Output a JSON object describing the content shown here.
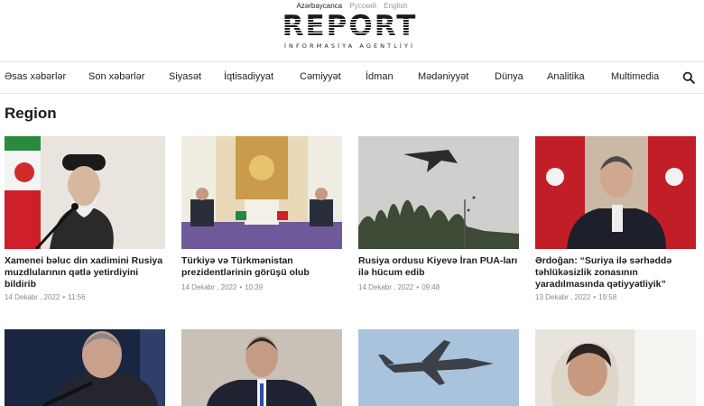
{
  "languages": [
    {
      "label": "Azərbaycanca",
      "active": true
    },
    {
      "label": "Русский",
      "active": false
    },
    {
      "label": "English",
      "active": false
    }
  ],
  "logo": {
    "word": "REPORT",
    "subtitle": "İNFORMASİYA AGENTLİYİ"
  },
  "nav": [
    "Əsas xəbərlər",
    "Son xəbərlər",
    "Siyasət",
    "İqtisadiyyat",
    "Cəmiyyət",
    "İdman",
    "Mədəniyyət",
    "Dünya",
    "Analitika",
    "Multimedia"
  ],
  "page_title": "Region",
  "articles": [
    {
      "title": "Xamenei bəluc din xadimini Rusiya muzdlularının qətlə yetirdiyini bildirib",
      "date": "14 Dekabr , 2022",
      "time": "11:56"
    },
    {
      "title": "Türkiyə və Türkmənistan prezidentlərinin görüşü olub",
      "date": "14 Dekabr , 2022",
      "time": "10:39"
    },
    {
      "title": "Rusiya ordusu Kiyevə İran PUA-ları ilə hücum edib",
      "date": "14 Dekabr , 2022",
      "time": "09:48"
    },
    {
      "title": "Ərdoğan: “Suriya ilə sərhəddə təhlükəsizlik zonasının yaradılmasında qətiyyətliyik”",
      "date": "13 Dekabr , 2022",
      "time": "19:58"
    }
  ],
  "colors": {
    "text": "#1c1c1c",
    "muted": "#8a8a8a",
    "divider": "#e6e6e6",
    "flag_red": "#d21f2a"
  }
}
